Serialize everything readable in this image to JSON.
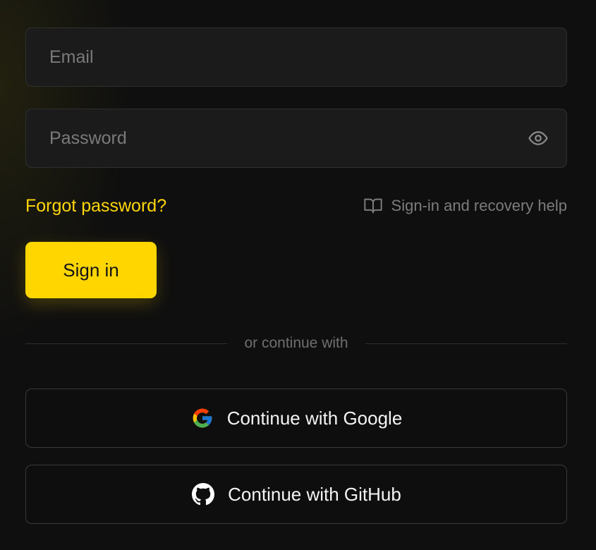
{
  "form": {
    "email": {
      "placeholder": "Email",
      "value": ""
    },
    "password": {
      "placeholder": "Password",
      "value": ""
    },
    "forgot_label": "Forgot password?",
    "help_label": "Sign-in and recovery help",
    "signin_label": "Sign in",
    "divider_label": "or continue with"
  },
  "social": {
    "google_label": "Continue with Google",
    "github_label": "Continue with GitHub"
  },
  "icons": {
    "password_toggle": "eye-icon",
    "help": "book-open-icon",
    "google": "google-logo-icon",
    "github": "github-logo-icon"
  },
  "colors": {
    "accent": "#ffd600",
    "background": "#0f0f0f",
    "field_background": "#1b1b1b",
    "muted_text": "#7c7c7c"
  }
}
